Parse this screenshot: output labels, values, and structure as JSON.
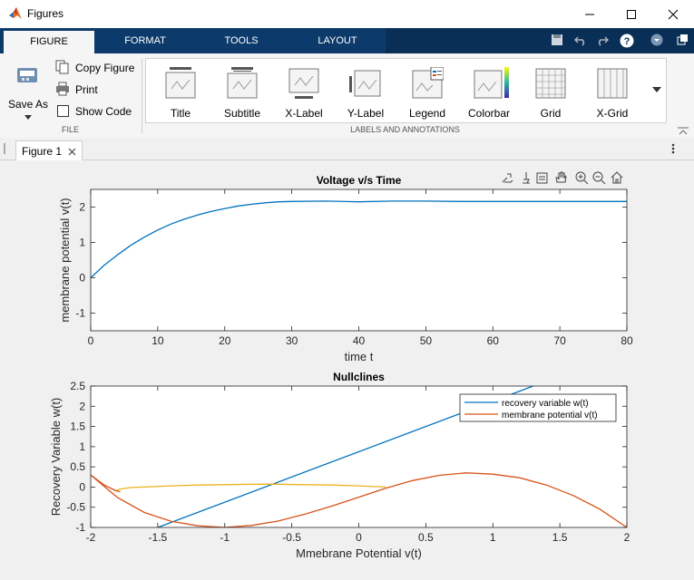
{
  "window": {
    "title": "Figures"
  },
  "tabs": [
    {
      "label": "FIGURE",
      "active": true
    },
    {
      "label": "FORMAT",
      "active": false
    },
    {
      "label": "TOOLS",
      "active": false
    },
    {
      "label": "LAYOUT",
      "active": false
    }
  ],
  "ribbon": {
    "file": {
      "save_as": "Save As",
      "copy_figure": "Copy Figure",
      "print": "Print",
      "show_code": "Show Code",
      "section_label": "FILE"
    },
    "annotations": {
      "section_label": "LABELS AND ANNOTATIONS",
      "items": [
        "Title",
        "Subtitle",
        "X-Label",
        "Y-Label",
        "Legend",
        "Colorbar",
        "Grid",
        "X-Grid"
      ]
    }
  },
  "doc_tab": {
    "label": "Figure 1"
  },
  "colors": {
    "accent": "#0b3a6b",
    "series1": "#0072bd",
    "series2": "#d95319",
    "series3": "#edb120"
  },
  "chart_data": [
    {
      "type": "line",
      "title": "Voltage v/s Time",
      "xlabel": "time t",
      "ylabel": "membrane potential v(t)",
      "xlim": [
        0,
        80
      ],
      "ylim": [
        -1.5,
        2.5
      ],
      "xticks": [
        0,
        10,
        20,
        30,
        40,
        50,
        60,
        70,
        80
      ],
      "yticks": [
        -1,
        0,
        1,
        2
      ],
      "grid": false,
      "series": [
        {
          "x": [
            0,
            2,
            4,
            6,
            8,
            10,
            12,
            14,
            16,
            18,
            20,
            22,
            24,
            26,
            28,
            30,
            35,
            40,
            45,
            50,
            55,
            60,
            65,
            70,
            75,
            80
          ],
          "y": [
            0,
            0.35,
            0.65,
            0.92,
            1.15,
            1.35,
            1.52,
            1.66,
            1.78,
            1.88,
            1.96,
            2.03,
            2.08,
            2.12,
            2.15,
            2.16,
            2.17,
            2.15,
            2.17,
            2.17,
            2.16,
            2.16,
            2.16,
            2.16,
            2.16,
            2.16
          ]
        }
      ]
    },
    {
      "type": "line",
      "title": "Nullclines",
      "xlabel": "Mmebrane Potential v(t)",
      "ylabel": "Recovery Variable w(t)",
      "xlim": [
        -2,
        2
      ],
      "ylim": [
        -1,
        2.5
      ],
      "xticks": [
        -2,
        -1.5,
        -1,
        -0.5,
        0,
        0.5,
        1,
        1.5,
        2
      ],
      "yticks": [
        -1,
        -0.5,
        0,
        0.5,
        1,
        1.5,
        2,
        2.5
      ],
      "legend_position": "top-right",
      "series": [
        {
          "name": "recovery variable w(t)",
          "x": [
            -1.5,
            1.3
          ],
          "y": [
            -1,
            2.5
          ]
        },
        {
          "name": "membrane potential v(t)",
          "x": [
            -2,
            -1.8,
            -1.6,
            -1.4,
            -1.2,
            -1,
            -0.8,
            -0.6,
            -0.4,
            -0.2,
            0,
            0.2,
            0.4,
            0.6,
            0.8,
            1,
            1.2,
            1.4,
            1.6,
            1.8,
            2
          ],
          "y": [
            0.3,
            -0.26,
            -0.63,
            -0.85,
            -0.96,
            -1.0,
            -0.95,
            -0.84,
            -0.67,
            -0.47,
            -0.25,
            -0.03,
            0.16,
            0.29,
            0.35,
            0.32,
            0.23,
            0.05,
            -0.21,
            -0.55,
            -1.0
          ]
        },
        {
          "x": [
            -1.82,
            -1.78,
            -1.7,
            -1.6,
            -1.4,
            -1.2,
            -1,
            -0.8,
            -0.6,
            -0.4,
            -0.2,
            0,
            0.2
          ],
          "y": [
            -0.1,
            -0.05,
            -0.01,
            0.0,
            0.03,
            0.05,
            0.06,
            0.07,
            0.07,
            0.06,
            0.05,
            0.03,
            0.0
          ]
        },
        {
          "x": [
            -2,
            -1.9,
            -1.82,
            -1.78
          ],
          "y": [
            0.3,
            0.05,
            -0.08,
            -0.12
          ]
        }
      ]
    }
  ]
}
